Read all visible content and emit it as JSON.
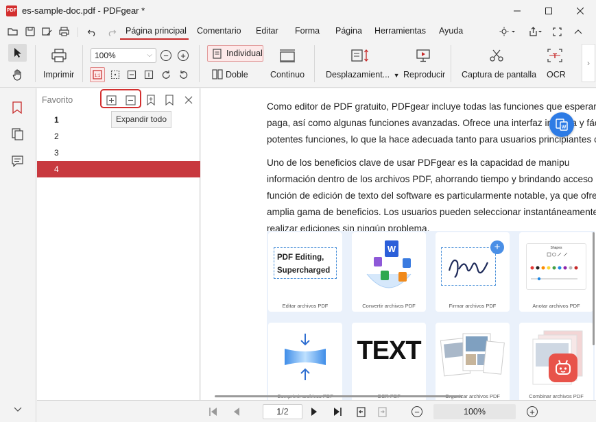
{
  "window": {
    "app_icon_text": "PDF",
    "title": "es-sample-doc.pdf - PDFgear *",
    "minimize_glyph": "—",
    "maximize_glyph": "☐",
    "close_glyph": "✕"
  },
  "menu": {
    "items": [
      "Página principal",
      "Comentario",
      "Editar",
      "Forma",
      "Página",
      "Herramientas",
      "Ayuda"
    ],
    "active_index": 0
  },
  "ribbon": {
    "print_label": "Imprimir",
    "zoom_value": "100%",
    "individual_label": "Individual",
    "double_label": "Doble",
    "continuous_label": "Continuo",
    "scroll_label": "Desplazamient...",
    "play_label": "Reproducir",
    "screenshot_label": "Captura de pantalla",
    "ocr_label": "OCR"
  },
  "panel": {
    "title": "Favorito",
    "tooltip": "Expandir todo",
    "bookmarks": [
      "1",
      "2",
      "3",
      "4"
    ],
    "selected_index": 3
  },
  "document": {
    "paragraph1": [
      "Como editor de PDF gratuito, PDFgear incluye todas las funciones que esperaría",
      "paga, así como algunas funciones avanzadas. Ofrece una interfaz intuitiva y fácil d",
      "potentes funciones, lo que la hace adecuada tanto para usuarios principiantes co"
    ],
    "paragraph2": [
      "Uno de los beneficios clave de usar PDFgear es la capacidad de manipu",
      "información dentro de los archivos PDF, ahorrando tiempo y brindando acceso",
      "función de edición de texto del software es particularmente notable, ya que ofrec",
      "amplia gama de beneficios. Los usuarios pueden seleccionar instantáneamente",
      "realizar ediciones sin ningún problema."
    ],
    "tiles": [
      {
        "caption": "Editar archivos PDF",
        "art_text": [
          "PDF Editing,",
          "Supercharged"
        ]
      },
      {
        "caption": "Convertir archivos PDF",
        "art_text": [
          "W"
        ]
      },
      {
        "caption": "Firmar archivos PDF",
        "art_text": []
      },
      {
        "caption": "Anotar archivos PDF",
        "art_text": [
          "Shapes"
        ]
      },
      {
        "caption": "Comprimir archivos PDF",
        "art_text": []
      },
      {
        "caption": "OCR PDF",
        "art_text": [
          "TEXT"
        ]
      },
      {
        "caption": "Organizar archivos PDF",
        "art_text": []
      },
      {
        "caption": "Combinar archivos PDF",
        "art_text": []
      }
    ]
  },
  "statusbar": {
    "current_page": "1",
    "total_pages": "/2",
    "zoom": "100%"
  },
  "colors": {
    "accent": "#c62828",
    "selection": "#c8393f",
    "highlight_box": "#d32f2f",
    "tile_bg": "#eaf1fb",
    "floating_button": "#2d7be5",
    "bot_button": "#e8534a"
  }
}
